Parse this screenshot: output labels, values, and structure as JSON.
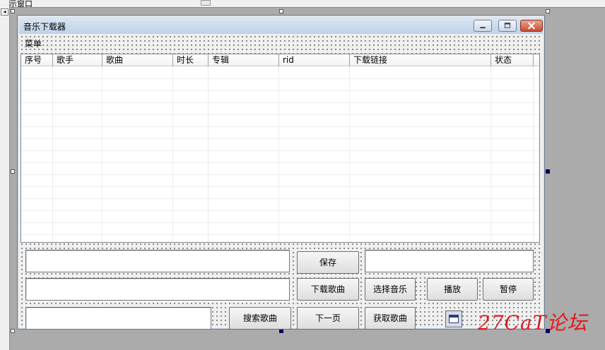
{
  "ide": {
    "top_label": "显示窗口"
  },
  "window": {
    "title": "音乐下载器",
    "menu_label": "菜单"
  },
  "list": {
    "columns": [
      "序号",
      "歌手",
      "歌曲",
      "时长",
      "专辑",
      "rid",
      "下载链接",
      "状态"
    ]
  },
  "buttons": {
    "save": "保存",
    "download": "下载歌曲",
    "select_music": "选择音乐",
    "play": "播放",
    "pause": "暂停",
    "search": "搜索歌曲",
    "next_page": "下一页",
    "fetch": "获取歌曲"
  },
  "inputs": {
    "path_value": "",
    "save_value": "",
    "link_value": "",
    "search_value": ""
  },
  "watermark": "27CaT论坛",
  "icons": {
    "calendar": "calendar-icon",
    "minimize": "minimize-icon",
    "maximize": "maximize-icon",
    "close": "close-icon"
  },
  "colors": {
    "title_bar": "#bfd2e8",
    "close_button": "#c84a32",
    "watermark": "#e3171d",
    "selection_handle": "#000060"
  }
}
